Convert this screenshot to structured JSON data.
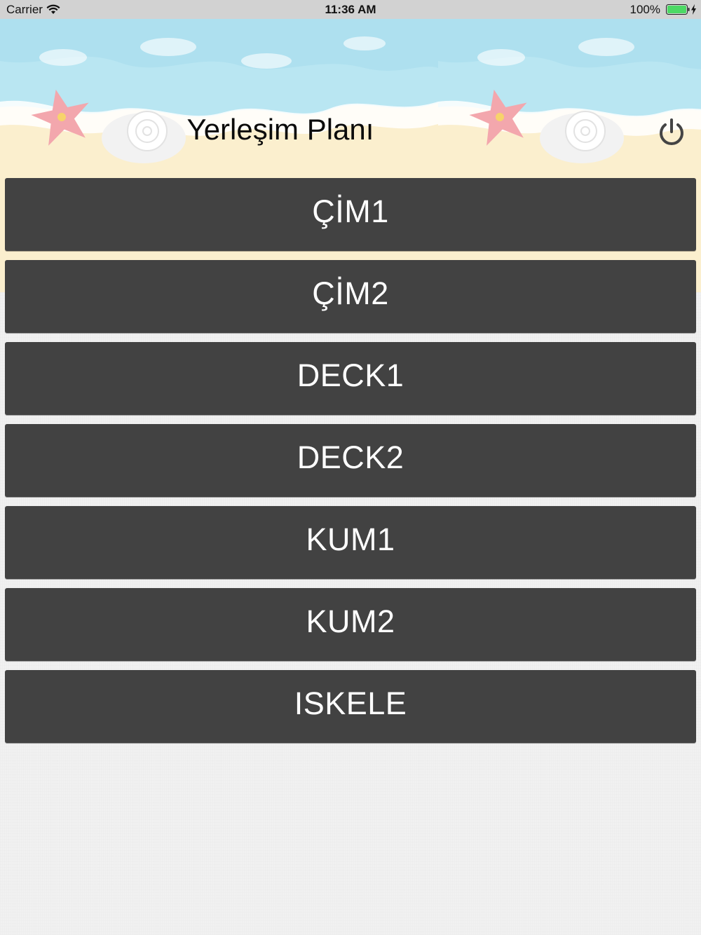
{
  "status_bar": {
    "carrier": "Carrier",
    "time": "11:36 AM",
    "battery": "100%",
    "battery_color": "#4cd964"
  },
  "header": {
    "title": "Yerleşim Planı",
    "power_icon": "power-icon"
  },
  "locations": [
    {
      "label": "ÇİM1"
    },
    {
      "label": "ÇİM2"
    },
    {
      "label": "DECK1"
    },
    {
      "label": "DECK2"
    },
    {
      "label": "KUM1"
    },
    {
      "label": "KUM2"
    },
    {
      "label": "ISKELE"
    }
  ],
  "colors": {
    "button_bg": "#424242",
    "button_text": "#ffffff",
    "sand": "#fbedc9",
    "water": "#b7e6f2"
  }
}
